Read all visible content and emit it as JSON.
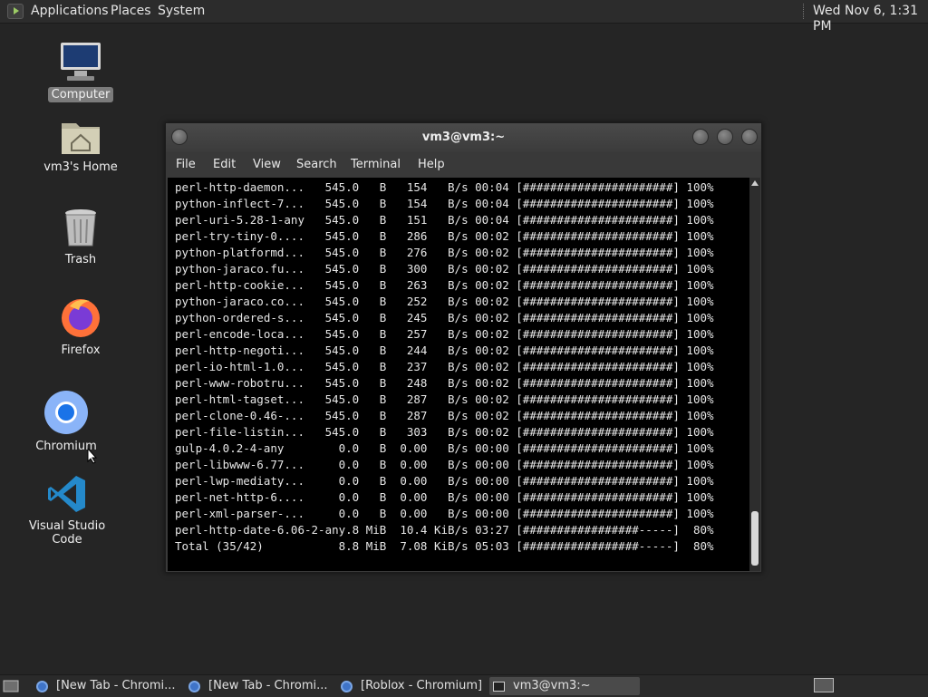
{
  "top_panel": {
    "menus": [
      "Applications",
      "Places",
      "System"
    ],
    "clock": "Wed Nov  6,  1:31 PM"
  },
  "desktop": {
    "icons": [
      {
        "label": "Computer",
        "icon": "computer-icon",
        "selected": true
      },
      {
        "label": "vm3's Home",
        "icon": "home-folder-icon"
      },
      {
        "label": "Trash",
        "icon": "trash-icon"
      },
      {
        "label": "Firefox",
        "icon": "firefox-icon"
      },
      {
        "label": "Chromium",
        "icon": "chromium-icon"
      },
      {
        "label": "Visual Studio Code",
        "icon": "vscode-icon"
      }
    ]
  },
  "terminal": {
    "title": "vm3@vm3:~",
    "menus": [
      "File",
      "Edit",
      "View",
      "Search",
      "Terminal",
      "Help"
    ],
    "lines": [
      "perl-http-daemon...   545.0   B   154   B/s 00:04 [######################] 100%",
      "python-inflect-7...   545.0   B   154   B/s 00:04 [######################] 100%",
      "perl-uri-5.28-1-any   545.0   B   151   B/s 00:04 [######################] 100%",
      "perl-try-tiny-0....   545.0   B   286   B/s 00:02 [######################] 100%",
      "python-platformd...   545.0   B   276   B/s 00:02 [######################] 100%",
      "python-jaraco.fu...   545.0   B   300   B/s 00:02 [######################] 100%",
      "perl-http-cookie...   545.0   B   263   B/s 00:02 [######################] 100%",
      "python-jaraco.co...   545.0   B   252   B/s 00:02 [######################] 100%",
      "python-ordered-s...   545.0   B   245   B/s 00:02 [######################] 100%",
      "perl-encode-loca...   545.0   B   257   B/s 00:02 [######################] 100%",
      "perl-http-negoti...   545.0   B   244   B/s 00:02 [######################] 100%",
      "perl-io-html-1.0...   545.0   B   237   B/s 00:02 [######################] 100%",
      "perl-www-robotru...   545.0   B   248   B/s 00:02 [######################] 100%",
      "perl-html-tagset...   545.0   B   287   B/s 00:02 [######################] 100%",
      "perl-clone-0.46-...   545.0   B   287   B/s 00:02 [######################] 100%",
      "perl-file-listin...   545.0   B   303   B/s 00:02 [######################] 100%",
      "gulp-4.0.2-4-any        0.0   B  0.00   B/s 00:00 [######################] 100%",
      "perl-libwww-6.77...     0.0   B  0.00   B/s 00:00 [######################] 100%",
      "perl-lwp-mediaty...     0.0   B  0.00   B/s 00:00 [######################] 100%",
      "perl-net-http-6....     0.0   B  0.00   B/s 00:00 [######################] 100%",
      "perl-xml-parser-...     0.0   B  0.00   B/s 00:00 [######################] 100%",
      "perl-http-date-6.06-2-any.8 MiB  10.4 KiB/s 03:27 [#################-----]  80%",
      "Total (35/42)           8.8 MiB  7.08 KiB/s 05:03 [#################-----]  80%"
    ]
  },
  "taskbar": {
    "tasks": [
      {
        "label": "[New Tab - Chromi...",
        "icon": "chromium-icon",
        "active": false
      },
      {
        "label": "[New Tab - Chromi...",
        "icon": "chromium-icon",
        "active": false
      },
      {
        "label": "[Roblox - Chromium]",
        "icon": "chromium-icon",
        "active": false
      },
      {
        "label": "vm3@vm3:~",
        "icon": "terminal-icon",
        "active": true
      }
    ]
  }
}
